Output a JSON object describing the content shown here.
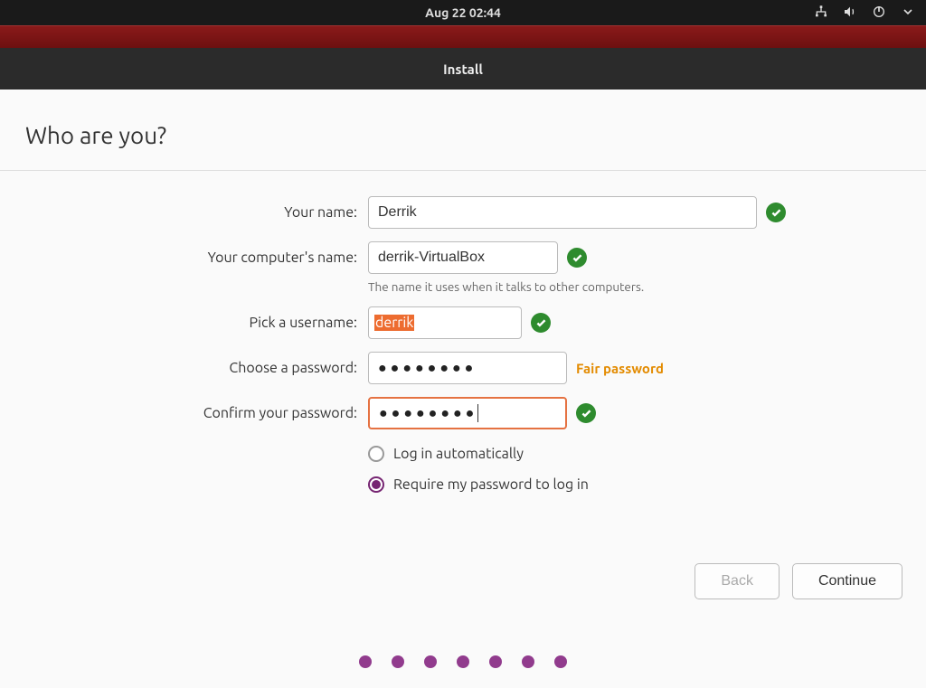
{
  "topbar": {
    "datetime": "Aug 22  02:44"
  },
  "titlebar": {
    "title": "Install"
  },
  "heading": "Who are you?",
  "form": {
    "name_label": "Your name:",
    "name_value": "Derrik",
    "computer_label": "Your computer's name:",
    "computer_value": "derrik-VirtualBox",
    "computer_hint": "The name it uses when it talks to other computers.",
    "username_label": "Pick a username:",
    "username_value": "derrik",
    "password_label": "Choose a password:",
    "password_mask": "●●●●●●●●",
    "password_strength": "Fair password",
    "confirm_label": "Confirm your password:",
    "confirm_mask": "●●●●●●●●",
    "radio_auto": "Log in automatically",
    "radio_require": "Require my password to log in",
    "login_selected": "require"
  },
  "buttons": {
    "back": "Back",
    "continue": "Continue"
  },
  "progress": {
    "total": 7
  }
}
